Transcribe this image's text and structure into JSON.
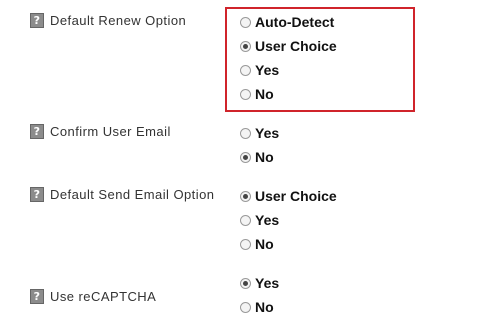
{
  "settings": [
    {
      "label": "Default Renew Option",
      "help_glyph": "?",
      "options": [
        "Auto-Detect",
        "User Choice",
        "Yes",
        "No"
      ],
      "selected": "User Choice"
    },
    {
      "label": "Confirm User Email",
      "help_glyph": "?",
      "options": [
        "Yes",
        "No"
      ],
      "selected": "No"
    },
    {
      "label": "Default Send Email Option",
      "help_glyph": "?",
      "options": [
        "User Choice",
        "Yes",
        "No"
      ],
      "selected": "User Choice"
    },
    {
      "label": "Use reCAPTCHA",
      "help_glyph": "?",
      "options": [
        "Yes",
        "No"
      ],
      "selected": "Yes"
    }
  ],
  "highlight_color": "#d0242b"
}
